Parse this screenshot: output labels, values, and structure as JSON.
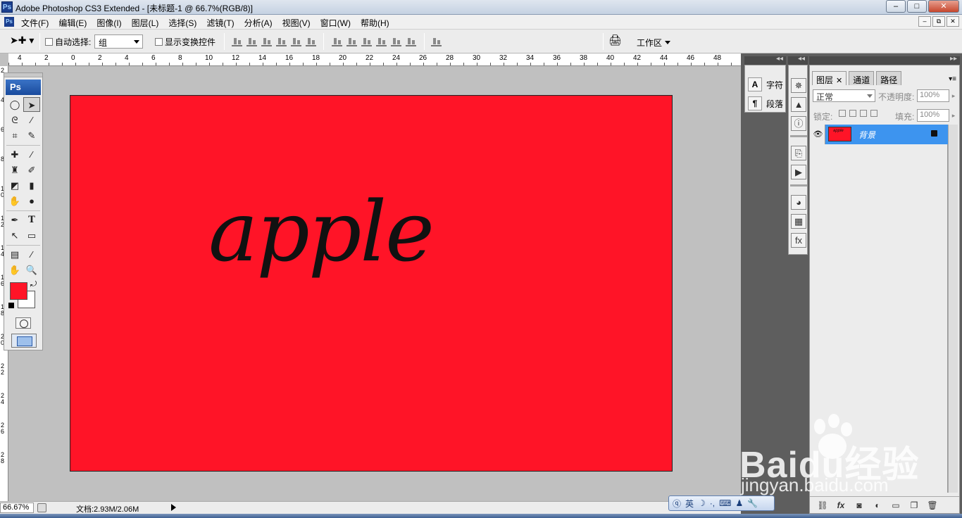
{
  "window": {
    "title": "Adobe Photoshop CS3 Extended - [未标题-1 @ 66.7%(RGB/8)]",
    "app_icon": "Ps",
    "buttons": {
      "minimize": "‒",
      "maximize": "□",
      "close": "✕"
    }
  },
  "menu": {
    "items": [
      "文件(F)",
      "编辑(E)",
      "图像(I)",
      "图层(L)",
      "选择(S)",
      "滤镜(T)",
      "分析(A)",
      "视图(V)",
      "窗口(W)",
      "帮助(H)"
    ],
    "doc_buttons": {
      "minimize": "‒",
      "restore": "⧉",
      "close": "✕"
    }
  },
  "options": {
    "auto_select_label": "自动选择:",
    "auto_select_value": "组",
    "show_transform_label": "显示变换控件",
    "workspace_label": "工作区"
  },
  "ruler": {
    "top_numbers": [
      "4",
      "2",
      "0",
      "2",
      "4",
      "6",
      "8",
      "10",
      "12",
      "14",
      "16",
      "18",
      "20",
      "22",
      "24",
      "26",
      "28",
      "30",
      "32",
      "34",
      "36",
      "38",
      "40",
      "42",
      "44",
      "46",
      "48"
    ],
    "left_numbers": [
      "2",
      "4",
      "6",
      "8",
      "1 0",
      "1 2",
      "1 4",
      "1 6",
      "1 8",
      "2 0",
      "2 2",
      "2 4",
      "2 6",
      "2 8"
    ]
  },
  "document": {
    "background_color": "#ff1427",
    "text": "apple",
    "text_color": "#111111"
  },
  "toolbox": {
    "logo": "Ps",
    "foreground_color": "#ff1427",
    "background_color": "#ffffff",
    "tools": [
      [
        "ellipse-marquee-icon",
        "move-icon"
      ],
      [
        "lasso-icon",
        "magic-wand-icon"
      ],
      [
        "crop-icon",
        "slice-icon"
      ],
      [
        "healing-brush-icon",
        "brush-icon"
      ],
      [
        "clone-stamp-icon",
        "history-brush-icon"
      ],
      [
        "eraser-icon",
        "gradient-icon"
      ],
      [
        "blur-icon",
        "dodge-icon"
      ],
      [
        "pen-icon",
        "type-icon"
      ],
      [
        "path-select-icon",
        "shape-icon"
      ],
      [
        "notes-icon",
        "eyedropper-icon"
      ],
      [
        "hand-icon",
        "zoom-icon"
      ]
    ]
  },
  "status": {
    "zoom": "66.67%",
    "doc_info": "文档:2.93M/2.06M"
  },
  "char_panel": {
    "char_label": "字符",
    "para_label": "段落"
  },
  "layers_panel": {
    "tabs": [
      "图层",
      "通道",
      "路径"
    ],
    "blend_mode": "正常",
    "opacity_label": "不透明度:",
    "opacity_value": "100%",
    "lock_label": "锁定:",
    "fill_label": "填充:",
    "fill_value": "100%",
    "layer_name": "背景",
    "thumb_text": "apple",
    "bottom_icons": [
      "link-icon",
      "fx-icon",
      "mask-icon",
      "adjustment-icon",
      "folder-icon",
      "new-layer-icon",
      "trash-icon"
    ]
  },
  "ime": {
    "label": "英"
  },
  "watermark": {
    "main": "Baidu经验",
    "sub": "jingyan.baidu.com"
  }
}
